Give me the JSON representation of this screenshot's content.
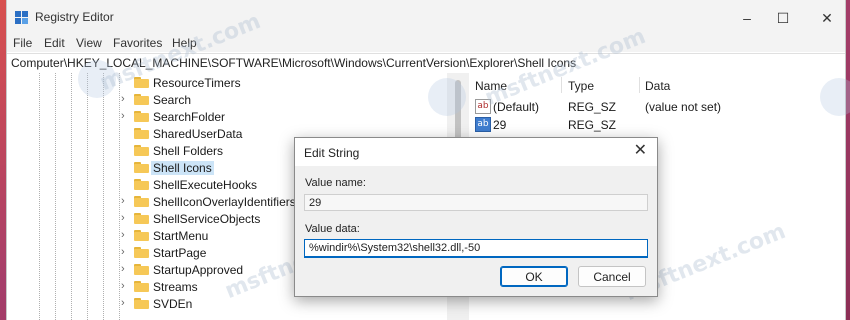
{
  "window": {
    "title": "Registry Editor",
    "controls": [
      "–",
      "☐",
      "✕"
    ]
  },
  "menu": [
    "File",
    "Edit",
    "View",
    "Favorites",
    "Help"
  ],
  "address": "Computer\\HKEY_LOCAL_MACHINE\\SOFTWARE\\Microsoft\\Windows\\CurrentVersion\\Explorer\\Shell Icons",
  "tree": {
    "items": [
      {
        "label": "ResourceTimers",
        "expandable": false
      },
      {
        "label": "Search",
        "expandable": true
      },
      {
        "label": "SearchFolder",
        "expandable": true
      },
      {
        "label": "SharedUserData",
        "expandable": false
      },
      {
        "label": "Shell Folders",
        "expandable": false
      },
      {
        "label": "Shell Icons",
        "expandable": false,
        "selected": true
      },
      {
        "label": "ShellExecuteHooks",
        "expandable": false
      },
      {
        "label": "ShellIconOverlayIdentifiers",
        "expandable": true
      },
      {
        "label": "ShellServiceObjects",
        "expandable": true
      },
      {
        "label": "StartMenu",
        "expandable": true
      },
      {
        "label": "StartPage",
        "expandable": true
      },
      {
        "label": "StartupApproved",
        "expandable": true
      },
      {
        "label": "Streams",
        "expandable": true
      },
      {
        "label": "SVDEn",
        "expandable": true
      }
    ]
  },
  "values": {
    "columns": [
      "Name",
      "Type",
      "Data"
    ],
    "rows": [
      {
        "icon": "ab",
        "name": "(Default)",
        "type": "REG_SZ",
        "data": "(value not set)"
      },
      {
        "icon": "ab",
        "name": "29",
        "type": "REG_SZ",
        "data": ""
      }
    ]
  },
  "dialog": {
    "title": "Edit String",
    "close": "✕",
    "value_name_label": "Value name:",
    "value_name": "29",
    "value_data_label": "Value data:",
    "value_data": "%windir%\\System32\\shell32.dll,-50",
    "ok_label": "OK",
    "cancel_label": "Cancel"
  },
  "watermark": "msftnext.com"
}
